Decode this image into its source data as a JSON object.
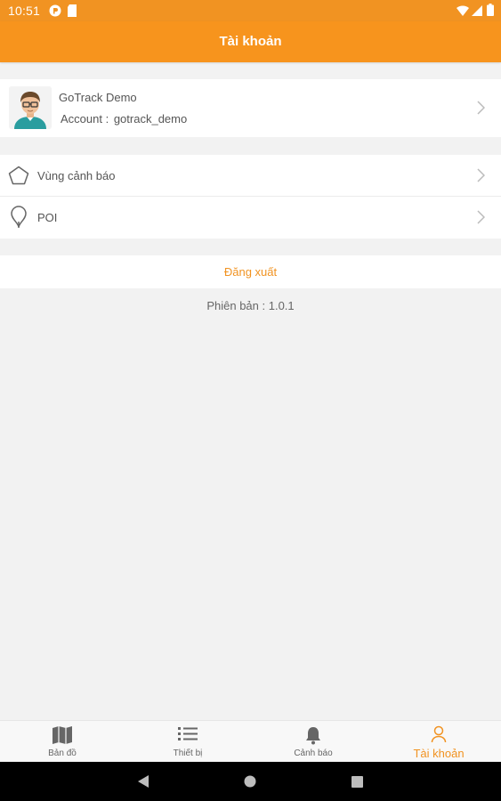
{
  "status_bar": {
    "time": "10:51"
  },
  "app_bar": {
    "title": "Tài khoản"
  },
  "profile": {
    "name": "GoTrack Demo",
    "account_label": "Account :",
    "account_value": "gotrack_demo"
  },
  "menu": {
    "items": [
      {
        "label": "Vùng cảnh báo",
        "icon": "pentagon-icon"
      },
      {
        "label": "POI",
        "icon": "map-pin-icon"
      }
    ]
  },
  "logout": {
    "label": "Đăng xuất"
  },
  "version": {
    "text": "Phiên bản : 1.0.1"
  },
  "tab_bar": {
    "active_tab": "Tài khoản",
    "tabs": [
      {
        "label": "Bản đồ",
        "icon": "map-icon"
      },
      {
        "label": "Thiết bị",
        "icon": "list-icon"
      },
      {
        "label": "Cảnh báo",
        "icon": "bell-icon"
      },
      {
        "label": "Tài khoản",
        "icon": "person-icon"
      }
    ]
  },
  "colors": {
    "accent": "#f7941d",
    "background": "#f2f2f2",
    "text": "#555555"
  }
}
